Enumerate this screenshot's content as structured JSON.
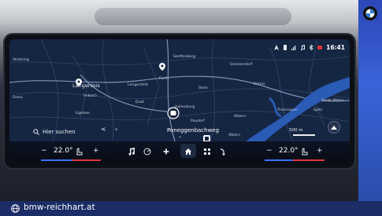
{
  "status_bar": {
    "time": "16:41"
  },
  "map": {
    "places": [
      {
        "label": "Stratzing",
        "cls": ""
      },
      {
        "label": "Senftenberg",
        "cls": ""
      },
      {
        "label": "Gneixendorf",
        "cls": ""
      },
      {
        "label": "Furth",
        "cls": ""
      },
      {
        "label": "Stein",
        "cls": ""
      },
      {
        "label": "Lengenfeld",
        "cls": ""
      },
      {
        "label": "Langenlois",
        "cls": ""
      },
      {
        "label": "Krems",
        "cls": ""
      },
      {
        "label": "Dross",
        "cls": ""
      },
      {
        "label": "Imbach",
        "cls": ""
      },
      {
        "label": "Droß",
        "cls": ""
      },
      {
        "label": "Egelsee",
        "cls": ""
      },
      {
        "label": "Hollenburg",
        "cls": ""
      },
      {
        "label": "Paudorf",
        "cls": ""
      },
      {
        "label": "Oberfucha",
        "cls": ""
      },
      {
        "label": "Traismauer",
        "cls": ""
      },
      {
        "label": "Spitz",
        "cls": ""
      },
      {
        "label": "Sankt Pölten",
        "cls": ""
      },
      {
        "label": "Albern",
        "cls": ""
      },
      {
        "label": "Albern",
        "cls": ""
      }
    ],
    "scale_label": "500 m"
  },
  "nav": {
    "search_label": "Hier suchen",
    "street": "Poneggenbachweg"
  },
  "climate": {
    "left_temp": "22.0°",
    "right_temp": "22.0°",
    "minus": "−",
    "plus": "+"
  },
  "footer": {
    "url": "bmw-reichhart.at"
  }
}
